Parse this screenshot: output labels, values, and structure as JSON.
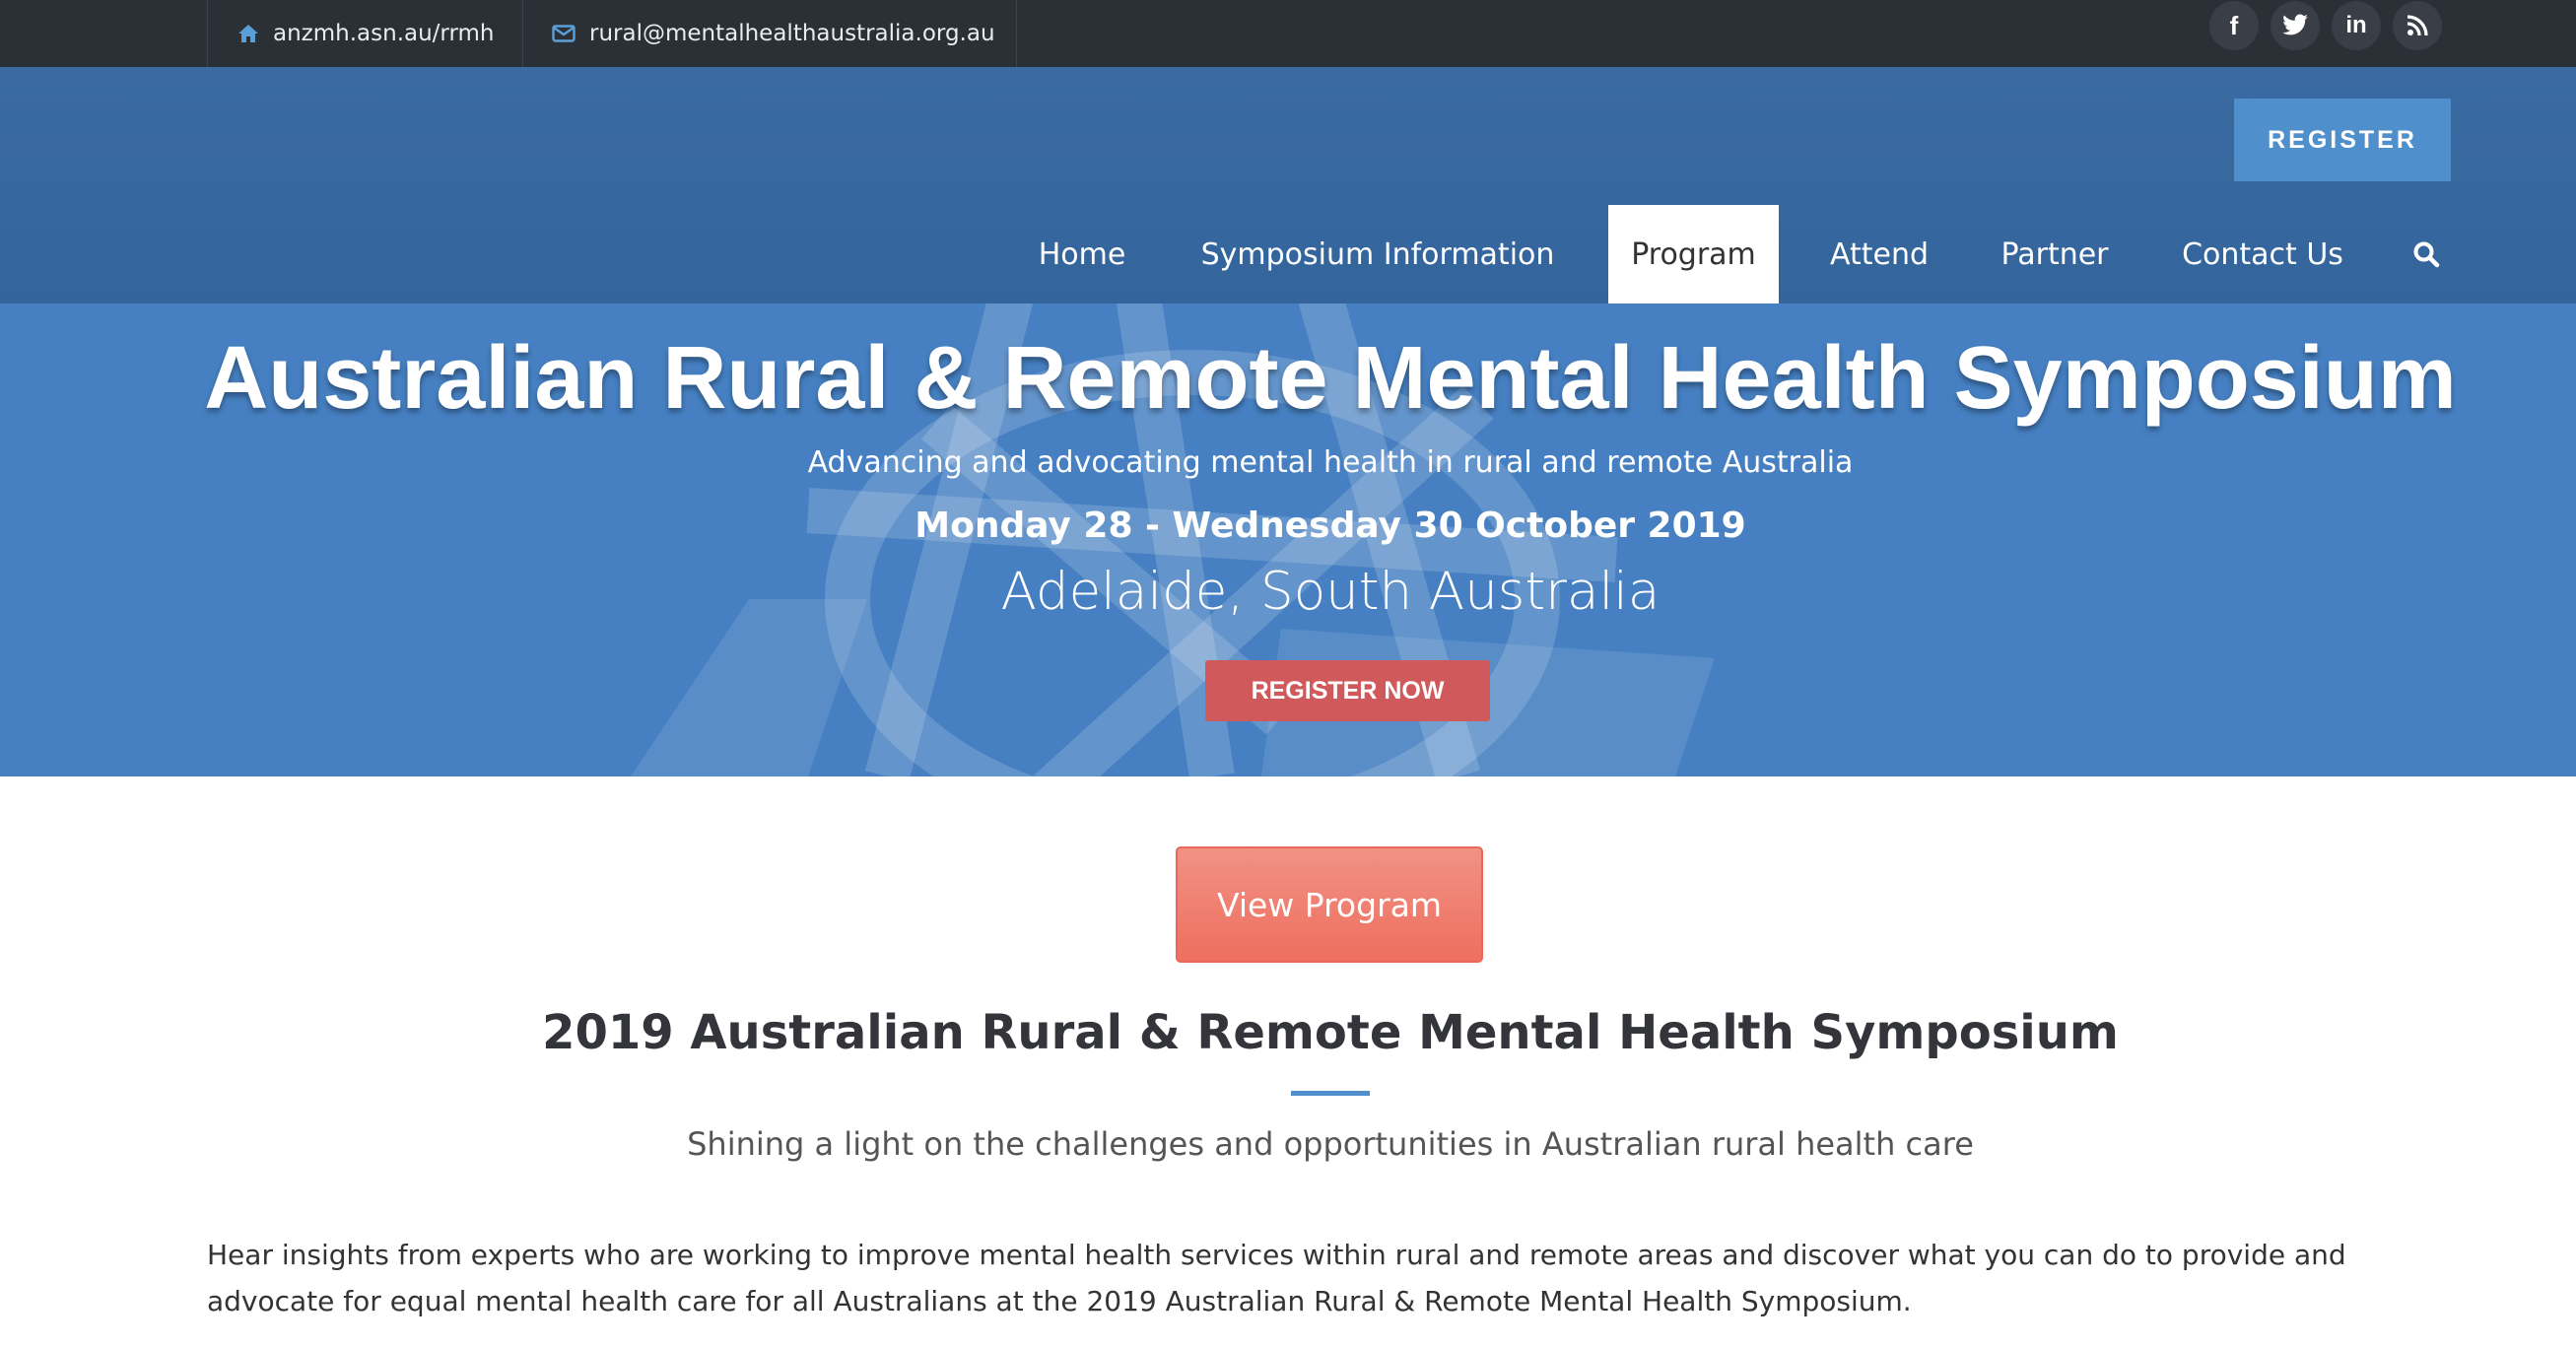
{
  "topbar": {
    "site_text": "anzmh.asn.au/rrmh",
    "email_text": "rural@mentalhealthaustralia.org.au",
    "icons": {
      "site": "home-icon",
      "email": "envelope-icon",
      "facebook": "facebook-icon",
      "twitter": "twitter-icon",
      "linkedin": "linkedin-icon",
      "rss": "rss-icon"
    }
  },
  "header": {
    "register_label": "REGISTER",
    "nav": [
      {
        "label": "Home"
      },
      {
        "label": "Symposium Information"
      },
      {
        "label": "Program",
        "active": true
      },
      {
        "label": "Attend"
      },
      {
        "label": "Partner"
      },
      {
        "label": "Contact Us"
      }
    ],
    "search_icon": "search-icon"
  },
  "hero": {
    "title": "Australian Rural & Remote Mental Health Symposium",
    "subtitle": "Advancing and advocating mental health in rural and remote Australia",
    "dates": "Monday 28 - Wednesday 30 October 2019",
    "location": "Adelaide, South Australia",
    "register_now_label": "REGISTER NOW"
  },
  "main": {
    "view_program_label": "View Program",
    "title": "2019 Australian Rural & Remote Mental Health Symposium",
    "subtitle": "Shining a light on the challenges and opportunities in Australian rural health care",
    "paragraph": "Hear insights from experts who are working to improve mental health services within rural and remote areas and discover what you can do to provide and advocate for equal mental health care for all Australians at the 2019 Australian Rural & Remote Mental Health Symposium."
  },
  "colors": {
    "topbar_bg": "#2b2f36",
    "header_bg": "#33659c",
    "hero_bg": "#4680c2",
    "accent_blue": "#4f8fcb",
    "register_now_red": "#d05a5b",
    "view_program_coral": "#ee6f5f"
  }
}
